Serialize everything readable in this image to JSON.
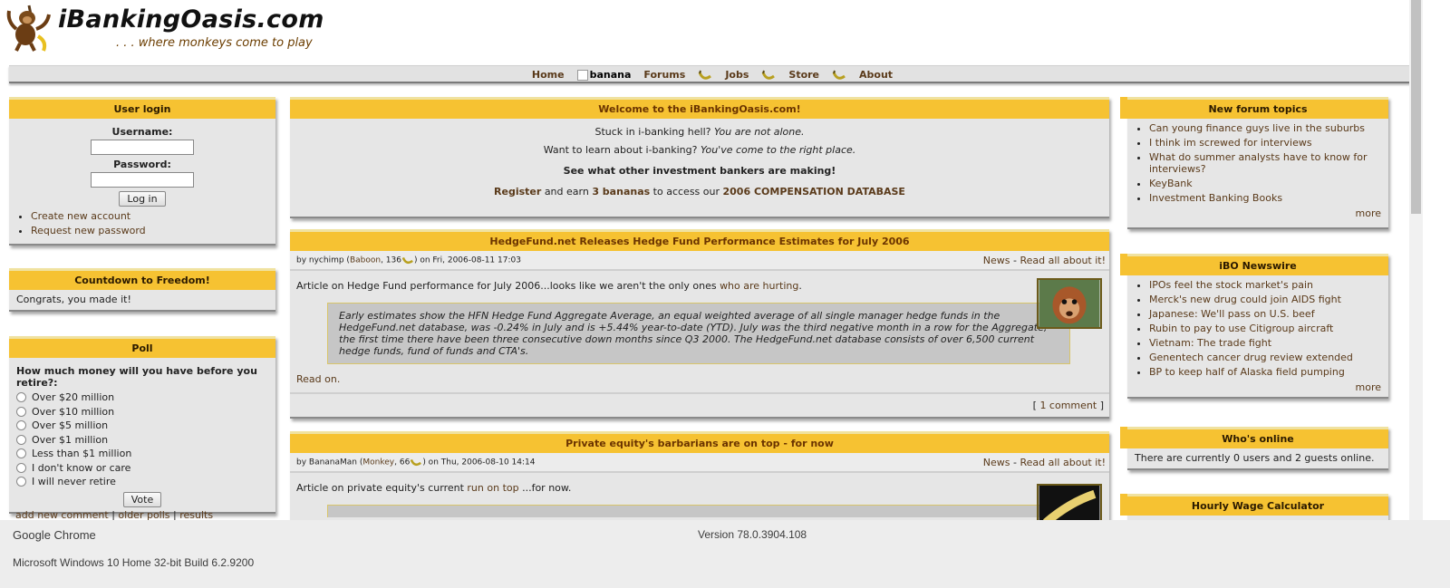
{
  "header": {
    "site_name": "iBankingOasis.com",
    "slogan": ". . . where monkeys come to play",
    "logo_icon": "monkey-logo-icon"
  },
  "nav": {
    "items": [
      "Home",
      "banana",
      "Forums",
      "Jobs",
      "Store",
      "About"
    ]
  },
  "login": {
    "title": "User login",
    "username_label": "Username:",
    "password_label": "Password:",
    "button": "Log in",
    "links": [
      "Create new account",
      "Request new password"
    ]
  },
  "countdown": {
    "title": "Countdown to Freedom!",
    "text": "Congrats, you made it!"
  },
  "poll": {
    "title": "Poll",
    "question": "How much money will you have before you retire?:",
    "options": [
      "Over $20 million",
      "Over $10 million",
      "Over $5 million",
      "Over $1 million",
      "Less than $1 million",
      "I don't know or care",
      "I will never retire"
    ],
    "vote_button": "Vote",
    "links": [
      "add new comment",
      "older polls",
      "results"
    ]
  },
  "welcome": {
    "title": "Welcome to the iBankingOasis.com!",
    "line1_a": "Stuck in i-banking hell?",
    "line1_b": "You are not alone.",
    "line2_a": "Want to learn about i-banking?",
    "line2_b": "You've come to the right place.",
    "line3": "See what other investment bankers are making!",
    "register": "Register",
    "earn_text": "and earn",
    "bananas": "3 bananas",
    "access_text": "to access our",
    "database": "2006 COMPENSATION DATABASE"
  },
  "story1": {
    "title": "HedgeFund.net Releases Hedge Fund Performance Estimates for July 2006",
    "by": "by nychimp (",
    "rank": "Baboon",
    "points": ", 136",
    "date": ") on Fri, 2006-08-11 17:03",
    "category": "News",
    "read_all": "Read all about it!",
    "intro": "Article on Hedge Fund performance for July 2006...looks like we aren't the only ones ",
    "intro_link": "who are hurting",
    "quote": "Early estimates show the HFN Hedge Fund Aggregate Average, an equal weighted average of all single manager hedge funds in the HedgeFund.net database, was -0.24% in July and is +5.44% year-to-date (YTD). July was the third negative month in a row for the Aggregate, the first time there have been three consecutive down months since Q3 2000. The HedgeFund.net database consists of over 6,500 current hedge funds, fund of funds and CTA's.",
    "read_on": "Read on.",
    "comments": "1 comment"
  },
  "story2": {
    "title": "Private equity's barbarians are on top - for now",
    "by": "by BananaMan (",
    "rank": "Monkey",
    "points": ", 66",
    "date": ") on Thu, 2006-08-10 14:14",
    "category": "News",
    "read_all": "Read all about it!",
    "intro": "Article on private equity's current ",
    "intro_link": "run on top",
    "intro_end": " ...for now."
  },
  "forum": {
    "title": "New forum topics",
    "items": [
      "Can young finance guys live in the suburbs",
      "I think im screwed for interviews",
      "What do summer analysts have to know for interviews?",
      "KeyBank",
      "Investment Banking Books"
    ],
    "more": "more"
  },
  "newswire": {
    "title": "iBO Newswire",
    "items": [
      "IPOs feel the stock market's pain",
      "Merck's new drug could join AIDS fight",
      "Japanese: We'll pass on U.S. beef",
      "Rubin to pay to use Citigroup aircraft",
      "Vietnam: The trade fight",
      "Genentech cancer drug review extended",
      "BP to keep half of Alaska field pumping"
    ],
    "more": "more"
  },
  "online": {
    "title": "Who's online",
    "text": "There are currently 0 users and 2 guests online."
  },
  "wage": {
    "title": "Hourly Wage Calculator"
  },
  "footer": {
    "browser": "Google Chrome",
    "os": "Microsoft Windows 10 Home 32-bit Build 6.2.9200",
    "version": "Version 78.0.3904.108"
  }
}
